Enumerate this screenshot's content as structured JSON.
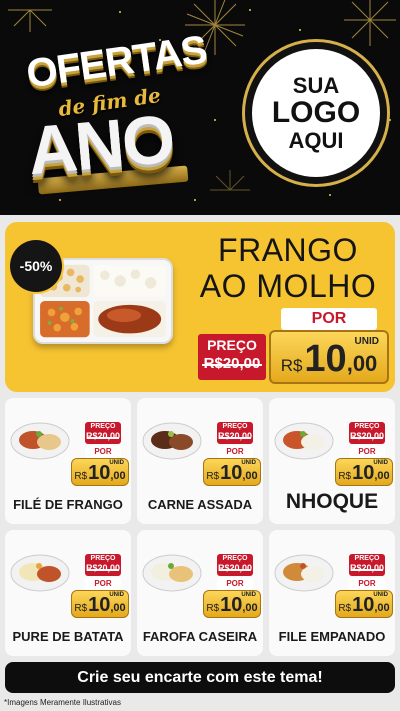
{
  "header": {
    "headline_line1": "OFERTAS",
    "headline_line2": "de fim de",
    "headline_line3": "ANO",
    "logo_line1": "SUA",
    "logo_line2": "LOGO",
    "logo_line3": "AQUI"
  },
  "featured": {
    "discount": "-50%",
    "title_line1": "FRANGO",
    "title_line2": "AO MOLHO",
    "old_label": "PREÇO",
    "old_price": "R$20,00",
    "por_label": "POR",
    "unid_label": "UNID",
    "currency": "R$",
    "price_int": "10",
    "price_dec": ",00"
  },
  "products": [
    {
      "name": "FILÉ DE FRANGO",
      "old_label": "PREÇO",
      "old_price": "R$20,00",
      "por_label": "POR",
      "unid_label": "UNID",
      "currency": "R$",
      "price_int": "10",
      "price_dec": ",00"
    },
    {
      "name": "CARNE ASSADA",
      "old_label": "PREÇO",
      "old_price": "R$20,00",
      "por_label": "POR",
      "unid_label": "UNID",
      "currency": "R$",
      "price_int": "10",
      "price_dec": ",00"
    },
    {
      "name": "NHOQUE",
      "old_label": "PREÇO",
      "old_price": "R$20,00",
      "por_label": "POR",
      "unid_label": "UNID",
      "currency": "R$",
      "price_int": "10",
      "price_dec": ",00"
    },
    {
      "name": "PURE DE BATATA",
      "old_label": "PREÇO",
      "old_price": "R$20,00",
      "por_label": "POR",
      "unid_label": "UNID",
      "currency": "R$",
      "price_int": "10",
      "price_dec": ",00"
    },
    {
      "name": "FAROFA CASEIRA",
      "old_label": "PREÇO",
      "old_price": "R$20,00",
      "por_label": "POR",
      "unid_label": "UNID",
      "currency": "R$",
      "price_int": "10",
      "price_dec": ",00"
    },
    {
      "name": "FILE EMPANADO",
      "old_label": "PREÇO",
      "old_price": "R$20,00",
      "por_label": "POR",
      "unid_label": "UNID",
      "currency": "R$",
      "price_int": "10",
      "price_dec": ",00"
    }
  ],
  "cta": "Crie seu encarte com este tema!",
  "disclaimer": "*Imagens Meramente Ilustrativas",
  "colors": {
    "header_bg": "#0a0a0a",
    "featured_bg": "#f6c331",
    "old_price_bg": "#c8192c",
    "price_gold": "#f2c23a",
    "cta_bg": "#0d0d0d"
  }
}
